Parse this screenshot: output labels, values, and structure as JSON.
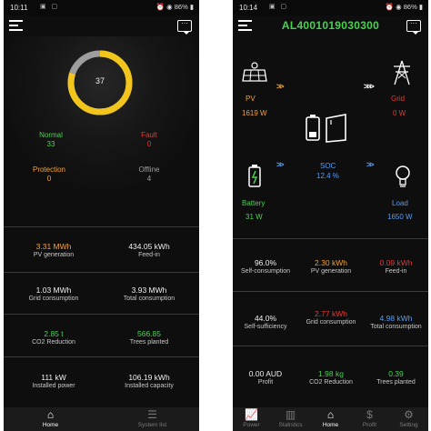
{
  "colors": {
    "green": "#4cd154",
    "yellow": "#f2c51c",
    "orange": "#f0a33a",
    "red": "#e53935",
    "blue": "#5a9cf0",
    "gray": "#9e9e9e"
  },
  "left": {
    "status": {
      "time": "10:11",
      "battery": "86%"
    },
    "donut": {
      "value": "37",
      "fraction_yellow": 0.8
    },
    "states": [
      {
        "label": "Normal",
        "value": "33"
      },
      {
        "label": "Fault",
        "value": "0"
      },
      {
        "label": "Protection",
        "value": "0"
      },
      {
        "label": "Offline",
        "value": "4"
      }
    ],
    "metrics": [
      {
        "value": "3.31 MWh",
        "label": "PV generation"
      },
      {
        "value": "434.05 kWh",
        "label": "Feed-in"
      },
      {
        "value": "1.03 MWh",
        "label": "Grid consumption"
      },
      {
        "value": "3.93 MWh",
        "label": "Total consumption"
      },
      {
        "value": "2.85 t",
        "label": "CO2 Reduction"
      },
      {
        "value": "566.85",
        "label": "Trees planted"
      },
      {
        "value": "111 kW",
        "label": "Installed power"
      },
      {
        "value": "106.19 kWh",
        "label": "Installed capacity"
      }
    ],
    "nav": [
      {
        "label": "Home",
        "icon": "home-icon"
      },
      {
        "label": "System list",
        "icon": "list-icon"
      }
    ]
  },
  "right": {
    "status": {
      "time": "10:14",
      "battery": "86%"
    },
    "device_id": "AL4001019030300",
    "flow": {
      "pv": {
        "label": "PV",
        "value": "1619 W"
      },
      "grid": {
        "label": "Grid",
        "value": "0 W"
      },
      "soc": {
        "label": "SOC",
        "value": "12.4 %"
      },
      "battery": {
        "label": "Battery",
        "value": "31 W"
      },
      "load": {
        "label": "Load",
        "value": "1650 W"
      }
    },
    "metrics": [
      {
        "value": "96.0%",
        "label": "Self-consumption"
      },
      {
        "value": "2.30 kWh",
        "label": "PV generation"
      },
      {
        "value": "0.09 kWh",
        "label": "Feed-in"
      },
      {
        "value": "44.0%",
        "label": "Self-sufficiency"
      },
      {
        "value": "2.77 kWh",
        "label": "Grid consumption"
      },
      {
        "value": "4.98 kWh",
        "label": "Total consumption"
      },
      {
        "value": "0.00 AUD",
        "label": "Profit"
      },
      {
        "value": "1.98 kg",
        "label": "CO2 Reduction"
      },
      {
        "value": "0.39",
        "label": "Trees planted"
      }
    ],
    "nav": [
      {
        "label": "Power",
        "icon": "power-chart-icon"
      },
      {
        "label": "Statistics",
        "icon": "statistics-icon"
      },
      {
        "label": "Home",
        "icon": "home-icon"
      },
      {
        "label": "Profit",
        "icon": "profit-icon"
      },
      {
        "label": "Setting",
        "icon": "gear-icon"
      }
    ]
  }
}
